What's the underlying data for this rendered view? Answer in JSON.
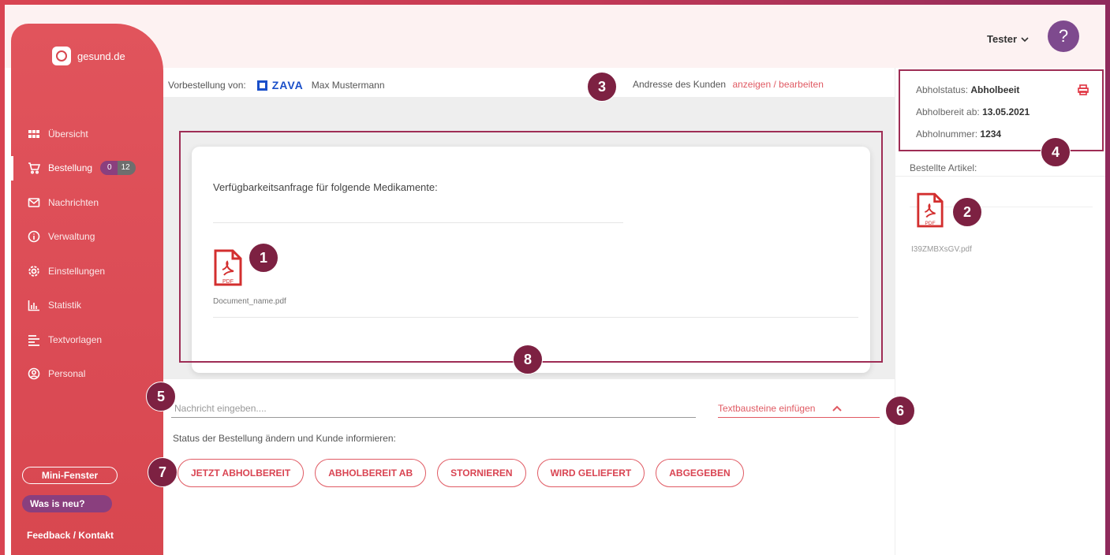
{
  "app": {
    "logo_text": "gesund.de",
    "user_name": "Tester",
    "help_icon": "?"
  },
  "sidebar": {
    "items": [
      {
        "label": "Übersicht",
        "icon": "grid-icon"
      },
      {
        "label": "Bestellung",
        "icon": "cart-icon",
        "badge_left": "0",
        "badge_right": "12",
        "active": true
      },
      {
        "label": "Nachrichten",
        "icon": "mail-icon"
      },
      {
        "label": "Verwaltung",
        "icon": "info-icon"
      },
      {
        "label": "Einstellungen",
        "icon": "gear-icon"
      },
      {
        "label": "Statistik",
        "icon": "bar-chart-icon"
      },
      {
        "label": "Textvorlagen",
        "icon": "text-lines-icon"
      },
      {
        "label": "Personal",
        "icon": "person-icon"
      }
    ],
    "mini_window": "Mini-Fenster",
    "whats_new": "Was is neu?",
    "feedback": "Feedback / Kontakt"
  },
  "order": {
    "preorder_label": "Vorbestellung von:",
    "partner_logo": "ZAVA",
    "customer_name": "Max Mustermann",
    "address_label": "Andresse des Kunden",
    "address_link": "anzeigen / bearbeiten"
  },
  "card": {
    "title": "Verfügbarkeitsanfrage für folgende Medikamente:",
    "document_name": "Document_name.pdf",
    "pdf_label": "PDF"
  },
  "message": {
    "placeholder": "Nachricht eingeben....",
    "textblocks": "Textbausteine einfügen",
    "chevron": "^"
  },
  "status_actions": {
    "label": "Status der Bestellung ändern und Kunde informieren:",
    "buttons": [
      "JETZT ABHOLBEREIT",
      "ABHOLBEREIT AB",
      "STORNIEREN",
      "WIRD GELIEFERT",
      "ABGEGEBEN"
    ]
  },
  "pickup": {
    "status_label": "Abholstatus:",
    "status_value": "Abholbeeit",
    "ready_label": "Abholbereit ab:",
    "ready_value": "13.05.2021",
    "number_label": "Abholnummer:",
    "number_value": "1234",
    "ordered_items_label": "Bestellte Artikel:",
    "file_name": "I39ZMBXsGV.pdf"
  },
  "markers": [
    "1",
    "2",
    "3",
    "4",
    "5",
    "6",
    "7",
    "8"
  ],
  "colors": {
    "brand_red": "#d94452",
    "accent_purple": "#7e4a8e",
    "marker": "#7d2142",
    "highlight_border": "#9e2d55"
  }
}
